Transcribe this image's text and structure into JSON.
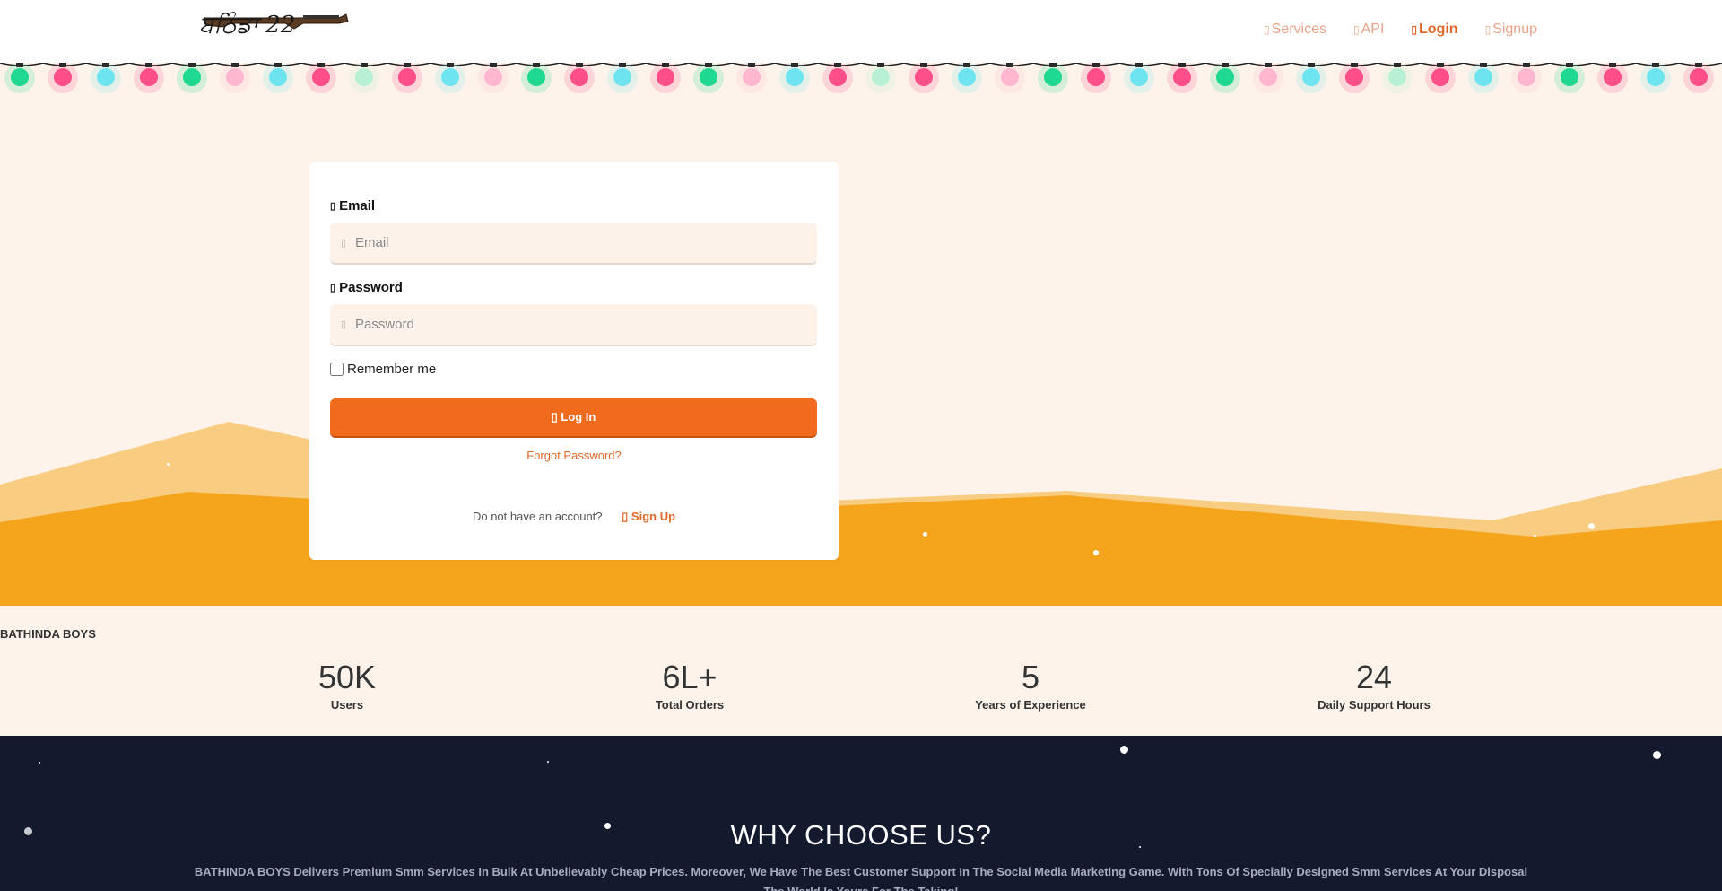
{
  "header": {
    "logo_text": "ਬਠਿੰਡਾ 22",
    "nav": [
      {
        "label": "Services",
        "icon": "services-icon",
        "glyph": "▯",
        "active": false
      },
      {
        "label": "API",
        "icon": "api-icon",
        "glyph": "▯",
        "active": false
      },
      {
        "label": "Login",
        "icon": "login-icon",
        "glyph": "▯",
        "active": true
      },
      {
        "label": "Signup",
        "icon": "signup-icon",
        "glyph": "▯",
        "active": false
      }
    ]
  },
  "colors": {
    "accent": "#f06b1c",
    "nav_link": "#e8a48a",
    "hill_dark": "#f4a51c",
    "hill_light": "#f8cd82",
    "hero_bg": "#fdf3ea",
    "footer_bg": "#141a2e",
    "light_green": "#1ed98f",
    "light_pink": "#ff4f8b",
    "light_cyan": "#6fe4f1",
    "light_pale_pink": "#ffb8cf",
    "light_mint": "#b8f0d3"
  },
  "login": {
    "email_label": "Email",
    "email_glyph": "▯",
    "email_placeholder": "Email",
    "password_label": "Password",
    "password_glyph": "▯",
    "password_placeholder": "Password",
    "remember_label": "Remember me",
    "login_button": "▯ Log In",
    "forgot_link": "Forgot Password?",
    "no_account_text": "Do not have an account?",
    "signup_link": "▯ Sign Up"
  },
  "brand_name": "BATHINDA BOYS",
  "stats": [
    {
      "value": "50K",
      "label": "Users"
    },
    {
      "value": "6L+",
      "label": "Total Orders"
    },
    {
      "value": "5",
      "label": "Years of Experience"
    },
    {
      "value": "24",
      "label": "Daily Support Hours"
    }
  ],
  "why": {
    "title": "WHY CHOOSE US?",
    "text": "BATHINDA BOYS Delivers Premium Smm Services In Bulk At Unbelievably Cheap Prices. Moreover, We Have The Best Customer Support In The Social Media Marketing Game. With Tons Of Specially Designed Smm Services At Your Disposal The World Is Yours For The Taking!"
  }
}
